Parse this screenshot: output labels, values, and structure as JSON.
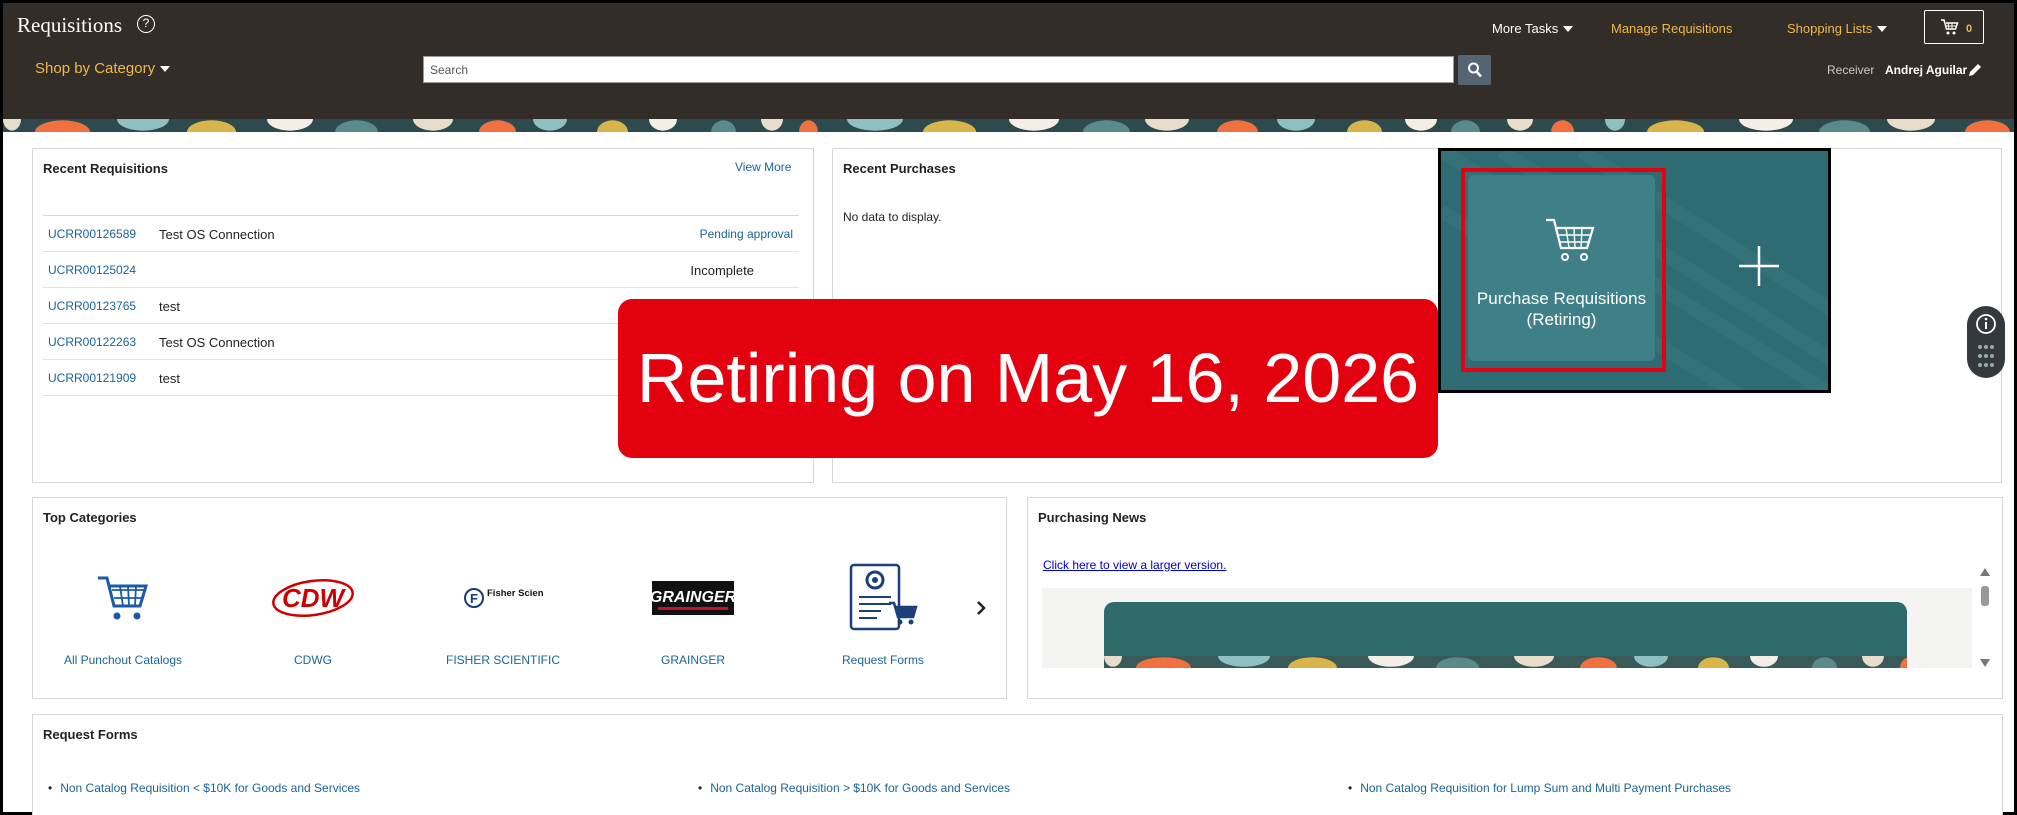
{
  "header": {
    "app_title": "Requisitions",
    "help_icon": "?",
    "more_tasks": "More Tasks",
    "manage_requisitions": "Manage Requisitions",
    "shopping_lists": "Shopping Lists",
    "cart_count": "0",
    "shop_by_category": "Shop by Category",
    "search_placeholder": "Search",
    "receiver_label": "Receiver",
    "receiver_name": "Andrej Aguilar"
  },
  "recent_requisitions": {
    "title": "Recent Requisitions",
    "view_more": "View More",
    "rows": [
      {
        "id": "UCRR00126589",
        "description": "Test OS Connection",
        "status": "Pending approval"
      },
      {
        "id": "UCRR00125024",
        "description": "",
        "status": "Incomplete"
      },
      {
        "id": "UCRR00123765",
        "description": "test",
        "status": ""
      },
      {
        "id": "UCRR00122263",
        "description": "Test OS Connection",
        "status": ""
      },
      {
        "id": "UCRR00121909",
        "description": "test",
        "status": ""
      }
    ]
  },
  "recent_purchases": {
    "title": "Recent Purchases",
    "empty_text": "No data to display."
  },
  "top_categories": {
    "title": "Top Categories",
    "items": [
      {
        "label": "All Punchout Catalogs",
        "icon": "shopping-cart-icon"
      },
      {
        "label": "CDWG",
        "logo_text": "CDW"
      },
      {
        "label": "FISHER SCIENTIFIC",
        "logo_text": "Fisher Scientific"
      },
      {
        "label": "GRAINGER",
        "logo_text": "GRAINGER"
      },
      {
        "label": "Request Forms",
        "icon": "request-form-icon"
      }
    ]
  },
  "purchasing_news": {
    "title": "Purchasing News",
    "larger_link": "Click here to view a larger version."
  },
  "request_forms": {
    "title": "Request Forms",
    "items": [
      "Non Catalog Requisition < $10K for Goods and Services",
      "Non Catalog Requisition > $10K for Goods and Services",
      "Non Catalog Requisition for Lump Sum and Multi Payment Purchases"
    ]
  },
  "overlay": {
    "retiring_text": "Retiring on May 16, 2026",
    "tile_label": "Purchase Requisitions (Retiring)"
  },
  "colors": {
    "header_bg": "#322d28",
    "accent_gold": "#f0b84a",
    "link_blue": "#1a6496",
    "alert_red": "#e3000f",
    "tile_teal": "#2f6b72"
  }
}
